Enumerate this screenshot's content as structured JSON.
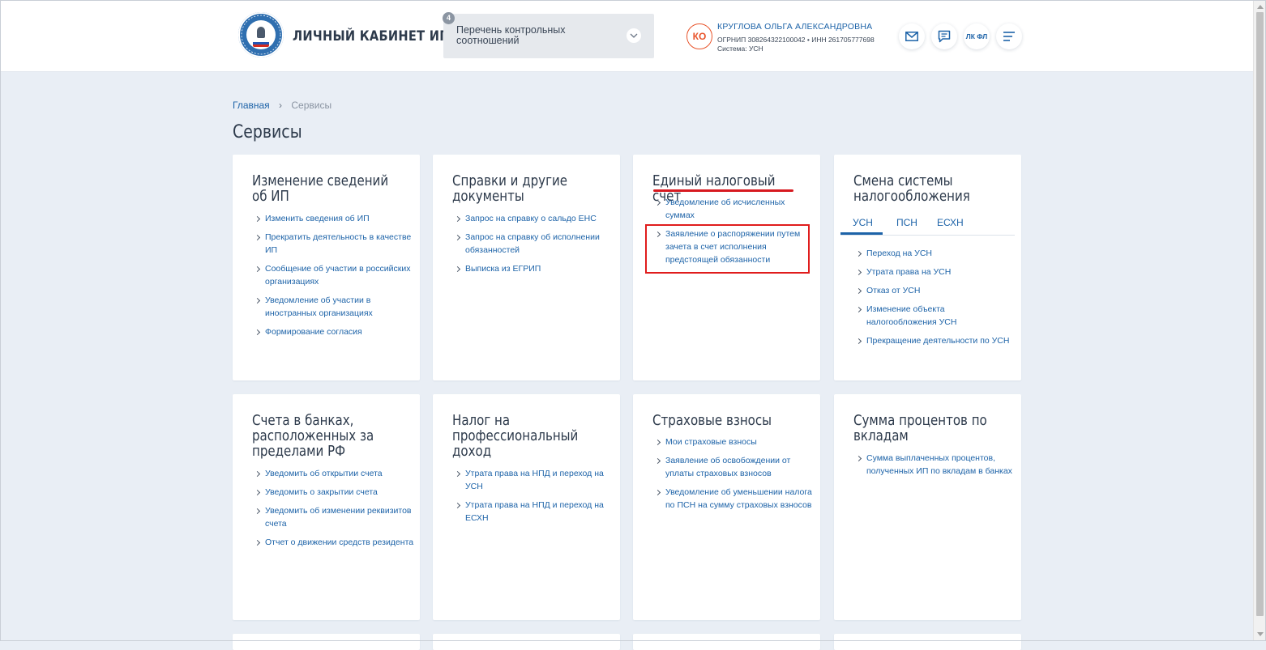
{
  "header": {
    "app_title": "ЛИЧНЫЙ КАБИНЕТ ИП",
    "select": {
      "badge": "4",
      "value": "Перечень контрольных соотношений"
    },
    "user": {
      "initials": "КО",
      "name": "КРУГЛОВА ОЛЬГА АЛЕКСАНДРОВНА",
      "ids": "ОГРНИП 308264322100042  •  ИНН 261705777698",
      "system": "Система: УСН"
    },
    "buttons": {
      "lk_fl": "ЛК ФЛ"
    }
  },
  "breadcrumb": {
    "home": "Главная",
    "separator": "›",
    "current": "Сервисы"
  },
  "page_title": "Сервисы",
  "cards": [
    {
      "title": "Изменение сведений об ИП",
      "links": [
        "Изменить сведения об ИП",
        "Прекратить деятельность в качестве ИП",
        "Сообщение об участии в российских организациях",
        "Уведомление об участии в иностранных организациях",
        "Формирование согласия"
      ]
    },
    {
      "title": "Справки и другие документы",
      "links": [
        "Запрос на справку о сальдо ЕНС",
        "Запрос на справку об исполнении обязанностей",
        "Выписка из ЕГРИП"
      ]
    },
    {
      "title": "Единый налоговый счет",
      "links": [
        "Уведомление об исчисленных суммах",
        "Заявление о распоряжении путем зачета в счет исполнения предстоящей обязанности"
      ]
    },
    {
      "title": "Смена системы налогообложения",
      "tabs": [
        "УСН",
        "ПСН",
        "ЕСХН"
      ],
      "links": [
        "Переход на УСН",
        "Утрата права на УСН",
        "Отказ от УСН",
        "Изменение объекта налогообложения УСН",
        "Прекращение деятельности по УСН"
      ]
    },
    {
      "title": "Счета в банках, расположенных за пределами РФ",
      "links": [
        "Уведомить об открытии счета",
        "Уведомить о закрытии счета",
        "Уведомить об изменении реквизитов счета",
        "Отчет о движении средств резидента"
      ]
    },
    {
      "title": "Налог на профессиональный доход",
      "links": [
        "Утрата права на НПД и переход на УСН",
        "Утрата права на НПД и переход на ЕСХН"
      ]
    },
    {
      "title": "Страховые взносы",
      "links": [
        "Мои страховые взносы",
        "Заявление об освобождении от уплаты страховых взносов",
        "Уведомление об уменьшении налога по ПСН на сумму страховых взносов"
      ]
    },
    {
      "title": "Сумма процентов по вкладам",
      "links": [
        "Сумма выплаченных процентов, полученных ИП по вкладам в банках"
      ]
    }
  ],
  "colors": {
    "accent": "#1d63a8",
    "highlight": "#e01c1c",
    "background": "#e9eef5",
    "avatar": "#e8542b"
  }
}
